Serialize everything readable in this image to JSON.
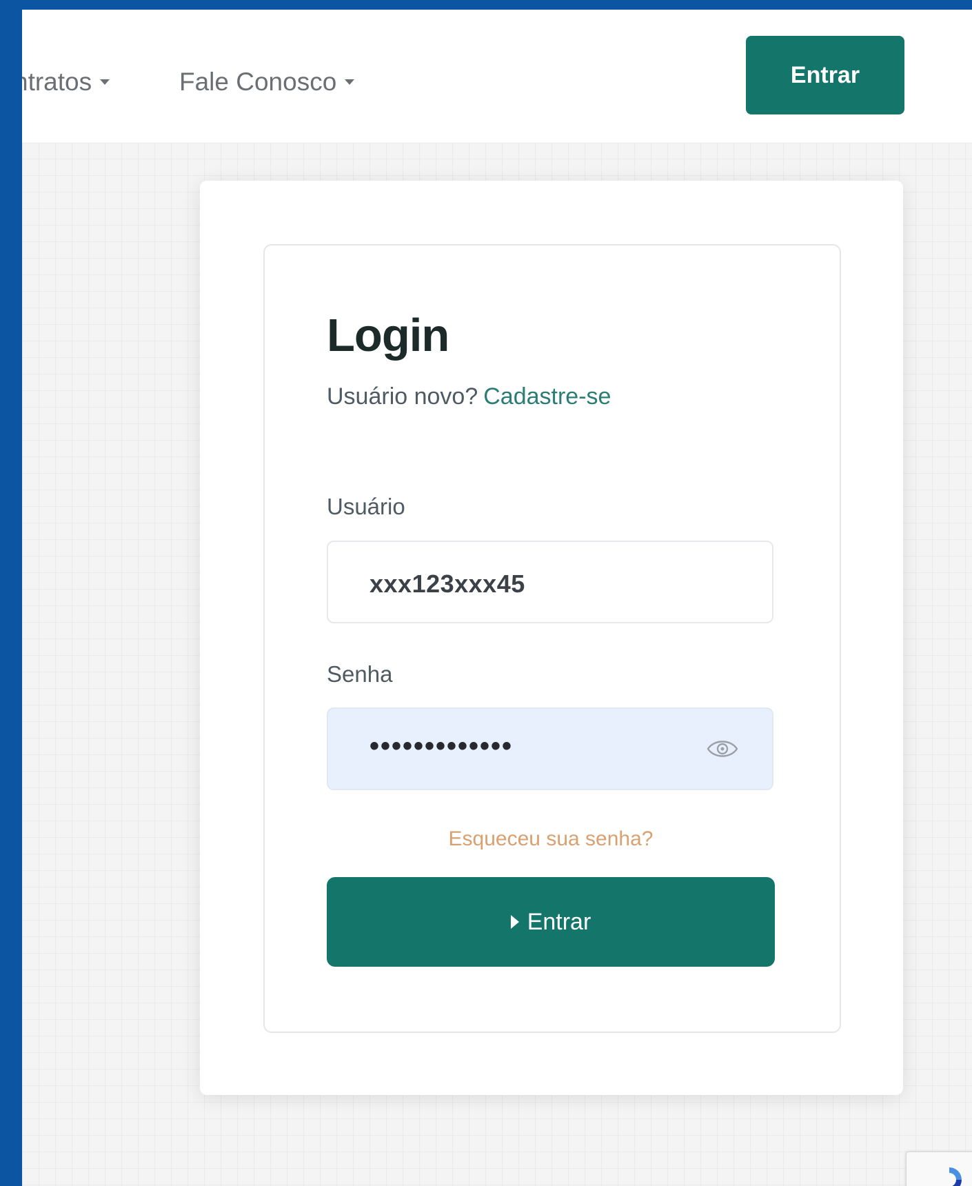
{
  "navbar": {
    "items": [
      {
        "label": "ntratos"
      },
      {
        "label": "Fale Conosco"
      }
    ],
    "login_button": "Entrar"
  },
  "login": {
    "title": "Login",
    "signup_prompt": "Usuário novo?",
    "signup_link": "Cadastre-se",
    "username_label": "Usuário",
    "username_value": "xxx123xxx45",
    "password_label": "Senha",
    "password_value": "•••••••••••••",
    "forgot_link": "Esqueceu sua senha?",
    "submit_label": "Entrar"
  },
  "colors": {
    "background_frame": "#0b55a2",
    "primary": "#14756b",
    "link": "#2b7d74",
    "forgot_link": "#d9a070",
    "password_field_bg": "#e8f0fe"
  },
  "icons": [
    "caret-down-icon",
    "eye-icon",
    "play-icon",
    "recaptcha-logo-icon"
  ]
}
